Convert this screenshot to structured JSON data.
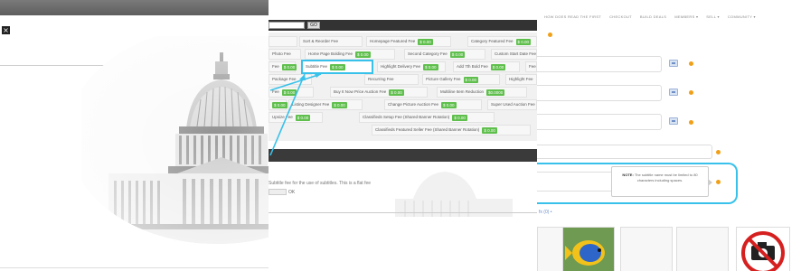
{
  "panel1": {
    "close_glyph": "×"
  },
  "panel2": {
    "go_label": "GO",
    "fee_cells": [
      {
        "label": "Sort & Reorder Fee",
        "price": ""
      },
      {
        "label": "Homepage Featured Fee",
        "price": "$ 0.00"
      },
      {
        "label": "Category Featured Fee",
        "price": "$ 0.00"
      },
      {
        "label": "Photo Fee",
        "price": "$ 0.00"
      },
      {
        "label": "Home Page Bolding Fee",
        "price": "$ 0.00"
      },
      {
        "label": "Second Category Fee",
        "price": "$ 0.00"
      },
      {
        "label": "Custom Start Date Fee",
        "price": ""
      },
      {
        "label": "Fee",
        "price": "$ 0.00"
      },
      {
        "label": "Subtitle Fee",
        "price": "$ 0.00"
      },
      {
        "label": "Highlight Delivery Fee",
        "price": "$ 0.00"
      },
      {
        "label": "Add 7th Bold Fee",
        "price": "$ 0.00"
      },
      {
        "label": "Fee",
        "price": ""
      },
      {
        "label": "Package Fee",
        "price": ""
      },
      {
        "label": "Recurring Fee",
        "price": ""
      },
      {
        "label": "Picture Gallery Fee",
        "price": "$ 0.00"
      },
      {
        "label": "Highlight Fee",
        "price": ""
      },
      {
        "label": "Fee",
        "price": "$ 0.00"
      },
      {
        "label": "Buy It Now Price Auction Fee",
        "price": "$ 0.00"
      },
      {
        "label": "Multiline Item Reduction",
        "price": "$0.0000"
      },
      {
        "label": "Fee",
        "price": "$ 0.00"
      },
      {
        "label": "Listing Designer Fee",
        "price": "$ 0.00"
      },
      {
        "label": "Change Picture Auction Fee",
        "price": "$ 0.00"
      },
      {
        "label": "Super Used Auction Fee",
        "price": ""
      },
      {
        "label": "Upsize Fee",
        "price": "$ 0.00"
      },
      {
        "label": "Classifieds Setup Fee (Shared Banner Rotation)",
        "price": "$ 0.00"
      },
      {
        "label": "Classifieds Featured Seller Fee (Shared Banner Rotation)",
        "price": "$ 0.00"
      }
    ],
    "desc_text": "Subtitle fee for the use of subtitles. This is a flat fee",
    "ok_label": "OK"
  },
  "panel3": {
    "nav": [
      "HOW DOES READ THE FIRST",
      "CHECKOUT",
      "BUILD DEALS",
      "MEMBERS ▾",
      "SELL ▾",
      "COMMUNITY ▾"
    ],
    "tooltip_title": "NOTE:",
    "tooltip_body": "The subtitle name must be limited to 80 characters including spaces.",
    "link_text": "fx (0) •"
  },
  "colors": {
    "highlight": "#38c1ea",
    "price_green": "#5fbf4c",
    "required_dot": "#f0a018"
  }
}
